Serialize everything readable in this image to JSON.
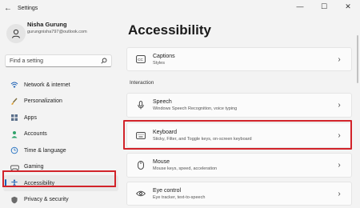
{
  "window": {
    "title": "Settings",
    "back_glyph": "←",
    "minimize_glyph": "—",
    "maximize_glyph": "☐",
    "close_glyph": "✕"
  },
  "profile": {
    "name": "Nisha Gurung",
    "email": "gurungnisha797@outlook.com"
  },
  "search": {
    "placeholder": "Find a setting"
  },
  "sidebar": {
    "items": [
      {
        "label": "Network & internet",
        "icon": "wifi-icon"
      },
      {
        "label": "Personalization",
        "icon": "brush-icon"
      },
      {
        "label": "Apps",
        "icon": "apps-icon"
      },
      {
        "label": "Accounts",
        "icon": "person-icon"
      },
      {
        "label": "Time & language",
        "icon": "globe-clock-icon"
      },
      {
        "label": "Gaming",
        "icon": "controller-icon"
      },
      {
        "label": "Accessibility",
        "icon": "accessibility-icon",
        "active": true
      },
      {
        "label": "Privacy & security",
        "icon": "shield-icon"
      }
    ]
  },
  "main": {
    "title": "Accessibility",
    "section_interaction": "Interaction",
    "cards": [
      {
        "title": "Captions",
        "subtitle": "Styles",
        "icon": "captions-icon"
      },
      {
        "title": "Speech",
        "subtitle": "Windows Speech Recognition, voice typing",
        "icon": "microphone-icon"
      },
      {
        "title": "Keyboard",
        "subtitle": "Sticky, Filter, and Toggle keys, on-screen keyboard",
        "icon": "keyboard-icon"
      },
      {
        "title": "Mouse",
        "subtitle": "Mouse keys, speed, acceleration",
        "icon": "mouse-icon"
      },
      {
        "title": "Eye control",
        "subtitle": "Eye tracker, text-to-speech",
        "icon": "eye-icon"
      }
    ],
    "chevron": "›"
  },
  "colors": {
    "accent": "#1a5fb4",
    "highlight_box": "#d2232a",
    "background": "#f3f3f3",
    "card": "#fbfbfb"
  }
}
